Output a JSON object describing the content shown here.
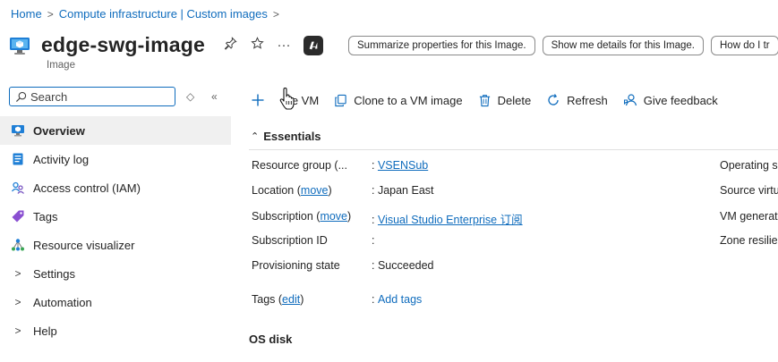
{
  "breadcrumb": {
    "home": "Home",
    "parent": "Compute infrastructure | Custom images",
    "sep": ">"
  },
  "header": {
    "title": "edge-swg-image",
    "subtitle": "Image",
    "more": "···",
    "suggestions": [
      "Summarize properties for this Image.",
      "Show me details for this Image.",
      "How do I tr"
    ]
  },
  "sidebar": {
    "search_placeholder": "Search",
    "items": [
      {
        "label": "Overview",
        "icon": "overview-icon",
        "active": true
      },
      {
        "label": "Activity log",
        "icon": "activity-log-icon"
      },
      {
        "label": "Access control (IAM)",
        "icon": "iam-icon"
      },
      {
        "label": "Tags",
        "icon": "tag-icon"
      },
      {
        "label": "Resource visualizer",
        "icon": "resource-visualizer-icon"
      },
      {
        "label": "Settings",
        "icon": "chevron-right-icon"
      },
      {
        "label": "Automation",
        "icon": "chevron-right-icon"
      },
      {
        "label": "Help",
        "icon": "chevron-right-icon"
      }
    ]
  },
  "toolbar": {
    "create_vm": "ate VM",
    "clone": "Clone to a VM image",
    "delete": "Delete",
    "refresh": "Refresh",
    "feedback": "Give feedback"
  },
  "essentials": {
    "heading": "Essentials",
    "rows": [
      {
        "key": "Resource group (...",
        "key_link": "",
        "value": "VSENSub",
        "value_is_link": true
      },
      {
        "key": "Location (",
        "key_link": "move",
        "key_suffix": ")",
        "value": "Japan East",
        "value_is_link": false
      },
      {
        "key": "Subscription (",
        "key_link": "move",
        "key_suffix": ")",
        "value": "Visual Studio Enterprise 订阅",
        "value_is_link": true
      },
      {
        "key": "Subscription ID",
        "key_link": "",
        "value": "",
        "value_is_link": false
      },
      {
        "key": "Provisioning state",
        "key_link": "",
        "value": "Succeeded",
        "value_is_link": false
      },
      {
        "key": "Tags (",
        "key_link": "edit",
        "key_suffix": ")",
        "value": "Add tags",
        "value_is_link": true
      }
    ],
    "right_keys": [
      "Operating s",
      "Source virtu",
      "VM generat",
      "Zone resilie"
    ]
  },
  "os_disk_heading": "OS disk",
  "colors": {
    "accent": "#0f6cbd",
    "text": "#242424"
  }
}
